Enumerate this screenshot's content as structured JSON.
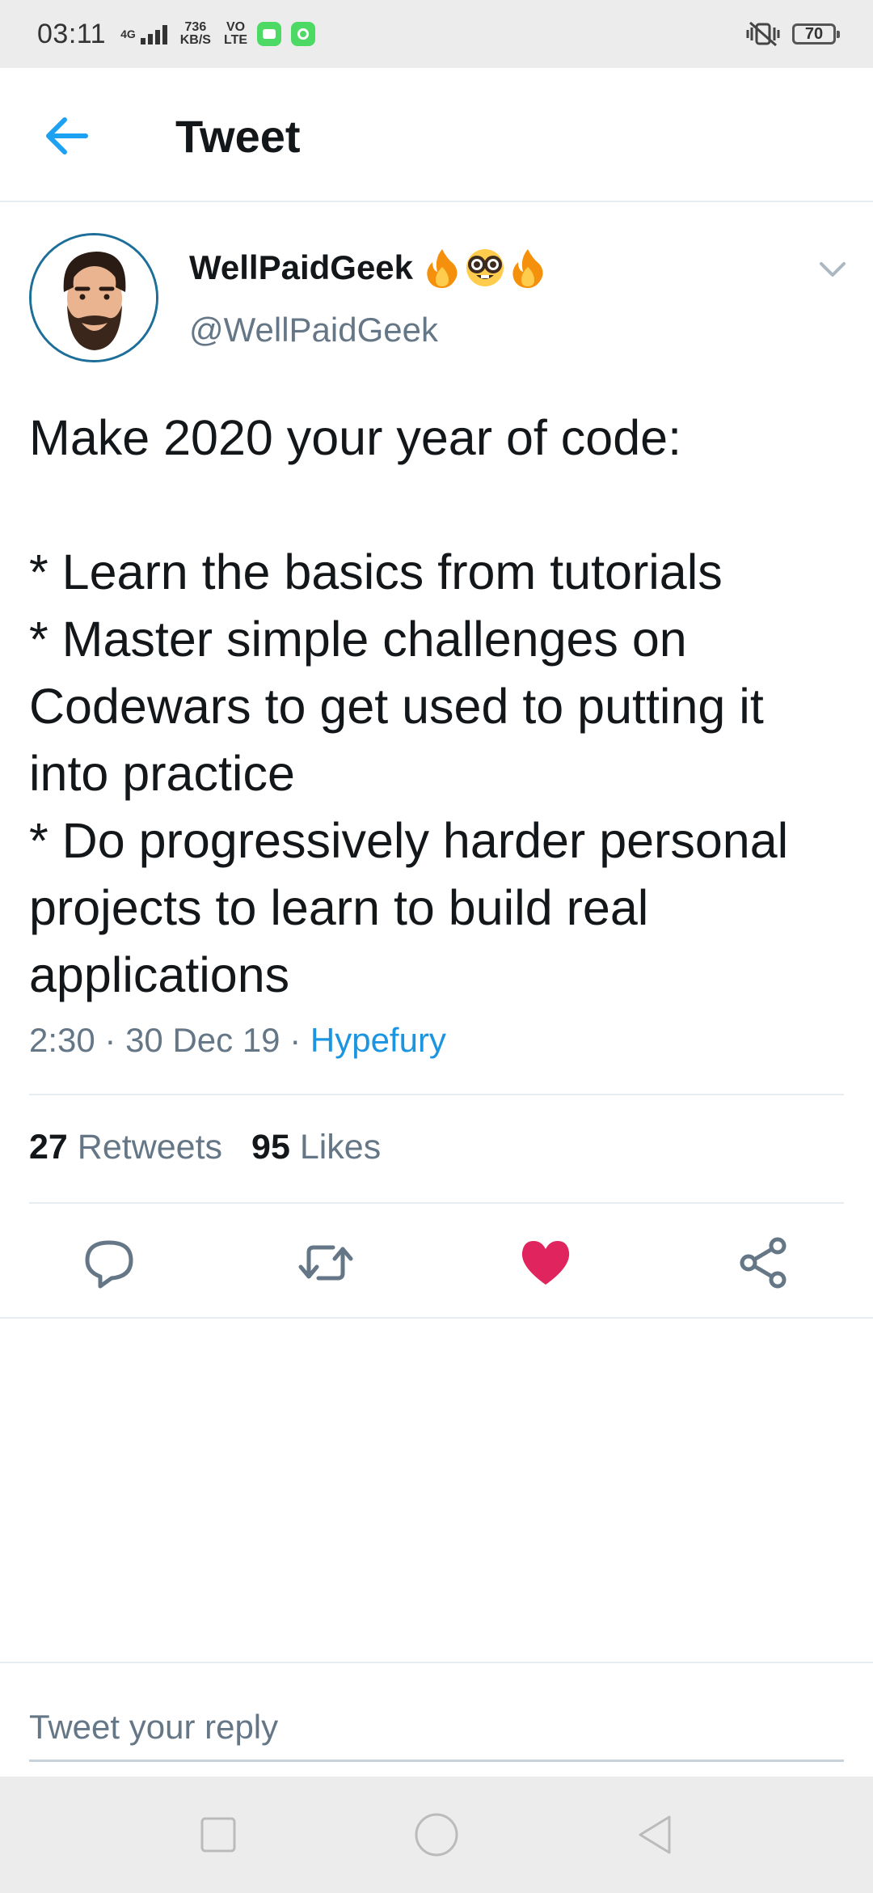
{
  "status_bar": {
    "time": "03:11",
    "network": "4G",
    "speed_value": "736",
    "speed_unit": "KB/S",
    "volte_top": "VO",
    "volte_bottom": "LTE",
    "battery": "70"
  },
  "header": {
    "title": "Tweet"
  },
  "tweet": {
    "display_name": "WellPaidGeek",
    "handle": "@WellPaidGeek",
    "text": "Make 2020 your year of code:\n\n* Learn the basics from tutorials\n* Master simple challenges on Codewars to get used to putting it into practice\n* Do progressively harder personal projects to learn to build real applications",
    "time": "2:30",
    "date": "30 Dec 19",
    "source": "Hypefury",
    "retweet_count": "27",
    "retweet_label": "Retweets",
    "like_count": "95",
    "like_label": "Likes",
    "liked": true
  },
  "reply": {
    "placeholder": "Tweet your reply"
  },
  "icons": {
    "back": "arrow-left-icon",
    "more": "chevron-down-icon",
    "reply": "speech-bubble-icon",
    "retweet": "retweet-icon",
    "like": "heart-icon",
    "share": "share-icon"
  },
  "colors": {
    "accent": "#1da1f2",
    "like": "#e0245e",
    "secondary_text": "#657786"
  }
}
